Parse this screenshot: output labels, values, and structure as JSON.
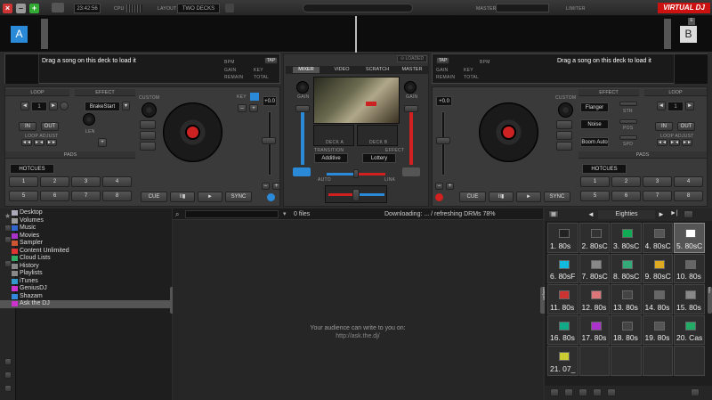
{
  "top": {
    "time": "23:42:56",
    "cpu_label": "CPU",
    "layout_label": "LAYOUT",
    "layout_value": "TWO DECKS",
    "master_label": "MASTER",
    "limiter_label": "LIMITER",
    "brand": "VIRTUAL DJ"
  },
  "deckA": {
    "letter": "A",
    "empty_text": "Drag a song on this deck to load it",
    "tap": "TAP",
    "bpm": "BPM",
    "gain": "GAIN",
    "key": "KEY",
    "remain": "REMAIN",
    "total": "TOTAL",
    "loop": "LOOP",
    "effect": "EFFECT",
    "effect_value": "BrakeStart",
    "loop_value": "1",
    "in": "IN",
    "out": "OUT",
    "len": "LEN",
    "loop_adjust": "LOOP ADJUST",
    "custom": "CUSTOM",
    "pads": "PADS",
    "hotcues": "HOTCUES",
    "pad_nums": [
      "1",
      "2",
      "3",
      "4",
      "5",
      "6",
      "7",
      "8"
    ],
    "cue": "CUE",
    "play": "►",
    "sync": "SYNC",
    "pitch": "+0.0",
    "keylbl": "KEY"
  },
  "deckB": {
    "letter": "B",
    "empty_text": "Drag a song on this deck to load it",
    "tap": "TAP",
    "bpm": "BPM",
    "gain": "GAIN",
    "key": "KEY",
    "remain": "REMAIN",
    "total": "TOTAL",
    "loop": "LOOP",
    "effect": "EFFECT",
    "fx1": "Flanger",
    "fx2": "Noise",
    "fx3": "Boom Auto",
    "str": "STR",
    "pos": "POS",
    "spd": "SPD",
    "loop_value": "1",
    "in": "IN",
    "out": "OUT",
    "loop_adjust": "LOOP ADJUST",
    "custom": "CUSTOM",
    "pads": "PADS",
    "hotcues": "HOTCUES",
    "pad_nums": [
      "1",
      "2",
      "3",
      "4",
      "5",
      "6",
      "7",
      "8"
    ],
    "cue": "CUE",
    "play": "►",
    "sync": "SYNC",
    "pitch": "+0.0"
  },
  "mixer": {
    "tabs": [
      "MIXER",
      "VIDEO",
      "SCRATCH",
      "MASTER"
    ],
    "gain": "GAIN",
    "deck_a": "DECK A",
    "deck_b": "DECK B",
    "transition": "TRANSITION",
    "effect": "EFFECT",
    "transition_value": "Additive",
    "effect_value": "Lottery",
    "auto": "AUTO",
    "link": "LINK",
    "crossfader_label": "CROSSFADER"
  },
  "browser": {
    "tree": [
      "Desktop",
      "Volumes",
      "Music",
      "Movies",
      "Sampler",
      "Content Unlimited",
      "Cloud Lists",
      "History",
      "Playlists",
      "iTunes",
      "GeniusDJ",
      "Shazam",
      "Ask the DJ"
    ],
    "files": "0 files",
    "status": "Downloading: ... / refreshing DRMs 78%",
    "msg1": "Your audience can write to you on:",
    "msg2": "http://ask.the.dj/",
    "sidebar_tab": "Folders",
    "sampler_tab": "Sampler",
    "info_tab": "Info"
  },
  "sampler": {
    "bank": "Eighties",
    "tiles": [
      "1. 80s",
      "2. 80sC",
      "3. 80sC",
      "4. 80sC",
      "5. 80sC",
      "6. 80sF",
      "7. 80sC",
      "8. 80sC",
      "9. 80sC",
      "10. 80s",
      "11. 80s",
      "12. 80s",
      "13. 80s",
      "14. 80s",
      "15. 80s",
      "16. 80s",
      "17. 80s",
      "18. 80s",
      "19. 80s",
      "20. Cas",
      "21. 07_"
    ],
    "colors": [
      "#222",
      "#333",
      "#1a5",
      "#555",
      "#fff",
      "#1bd",
      "#888",
      "#3a7",
      "#da2",
      "#666",
      "#c33",
      "#d77",
      "#444",
      "#666",
      "#888",
      "#1a8",
      "#a3c",
      "#444",
      "#555",
      "#2a6",
      "#cc3"
    ]
  },
  "colors": {
    "deckA_blue": "#2a8ad8",
    "deckB_red": "#d02020"
  }
}
